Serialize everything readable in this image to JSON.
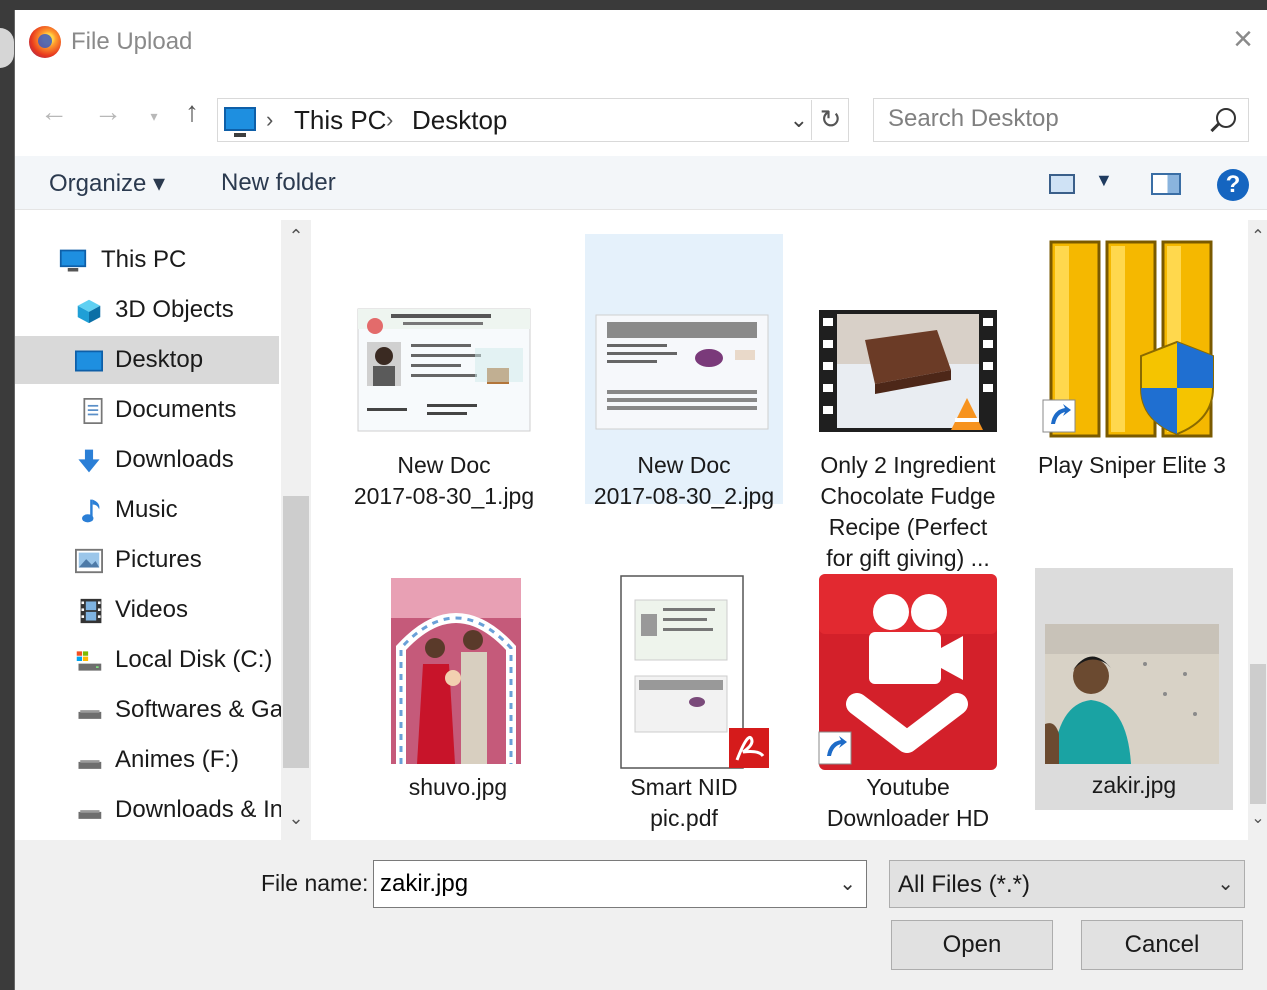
{
  "window": {
    "title": "File Upload",
    "close_glyph": "×"
  },
  "address": {
    "crumbs": [
      "This PC",
      "Desktop"
    ],
    "sep": "›"
  },
  "search": {
    "placeholder": "Search Desktop"
  },
  "toolbar": {
    "organize": "Organize ▾",
    "new_folder": "New folder",
    "help": "?"
  },
  "nav": {
    "items": [
      {
        "label": "This PC",
        "icon": "computer-icon"
      },
      {
        "label": "3D Objects",
        "icon": "cube-icon"
      },
      {
        "label": "Desktop",
        "icon": "desktop-icon",
        "selected": true
      },
      {
        "label": "Documents",
        "icon": "document-icon"
      },
      {
        "label": "Downloads",
        "icon": "download-arrow-icon"
      },
      {
        "label": "Music",
        "icon": "music-note-icon"
      },
      {
        "label": "Pictures",
        "icon": "picture-icon"
      },
      {
        "label": "Videos",
        "icon": "film-icon"
      },
      {
        "label": "Local Disk (C:)",
        "icon": "drive-icon"
      },
      {
        "label": "Softwares & Gar",
        "icon": "drive-icon"
      },
      {
        "label": "Animes (F:)",
        "icon": "drive-icon"
      },
      {
        "label": "Downloads & In",
        "icon": "drive-icon"
      }
    ]
  },
  "files": [
    {
      "name": "New Doc\n2017-08-30_1.jpg",
      "icon": "id-card-thumbnail"
    },
    {
      "name": "New Doc\n2017-08-30_2.jpg",
      "icon": "id-card-back-thumbnail",
      "hover": true
    },
    {
      "name": "Only 2 Ingredient\nChocolate Fudge\nRecipe (Perfect\nfor gift giving) ...",
      "icon": "video-film-thumbnail"
    },
    {
      "name": "Play Sniper Elite 3",
      "icon": "game-shortcut-icon"
    },
    {
      "name": "shuvo.jpg",
      "icon": "photo-thumbnail"
    },
    {
      "name": "Smart NID\npic.pdf",
      "icon": "pdf-thumbnail"
    },
    {
      "name": "Youtube\nDownloader HD",
      "icon": "youtube-downloader-shortcut-icon"
    },
    {
      "name": "zakir.jpg",
      "icon": "photo-thumbnail",
      "selected": true
    }
  ],
  "bottom": {
    "file_name_label": "File name:",
    "file_name_value": "zakir.jpg",
    "filter_value": "All Files (*.*)",
    "open_label": "Open",
    "cancel_label": "Cancel"
  }
}
